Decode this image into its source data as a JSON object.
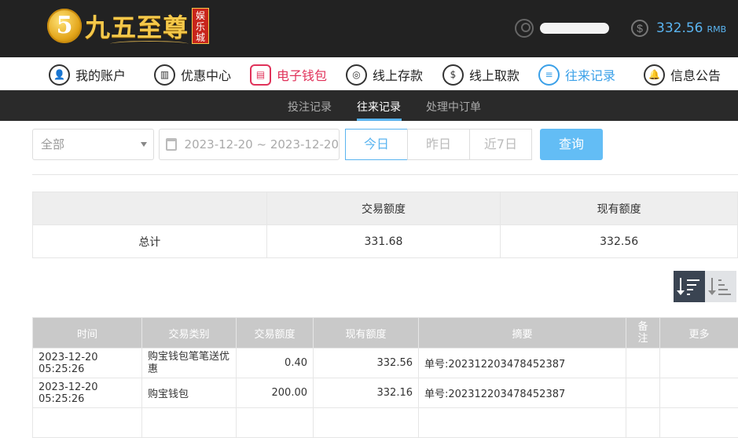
{
  "header": {
    "logo_badge": "5",
    "logo_text": "九五至尊",
    "logo_tag": "娱乐城",
    "balance_amount": "332.56",
    "balance_unit": "RMB"
  },
  "main_nav": [
    {
      "label": "我的账户",
      "icon": "user-circle-icon"
    },
    {
      "label": "优惠中心",
      "icon": "gift-icon"
    },
    {
      "label": "电子钱包",
      "icon": "wallet-icon"
    },
    {
      "label": "线上存款",
      "icon": "deposit-icon"
    },
    {
      "label": "线上取款",
      "icon": "withdraw-icon"
    },
    {
      "label": "往来记录",
      "icon": "records-icon"
    },
    {
      "label": "信息公告",
      "icon": "bell-icon"
    }
  ],
  "sub_nav": [
    {
      "label": "投注记录"
    },
    {
      "label": "往来记录"
    },
    {
      "label": "处理中订单"
    }
  ],
  "filters": {
    "type_select": "全部",
    "date_range": "2023-12-20 ~ 2023-12-20",
    "quick_today": "今日",
    "quick_yesterday": "昨日",
    "quick_7days": "近7日",
    "query_label": "查询"
  },
  "summary": {
    "col_trade": "交易额度",
    "col_current": "现有额度",
    "row_label": "总计",
    "trade_total": "331.68",
    "current_total": "332.56"
  },
  "records": {
    "headers": [
      "时间",
      "交易类别",
      "交易额度",
      "现有额度",
      "摘要",
      "备注",
      "更多"
    ],
    "rows": [
      {
        "time": "2023-12-20 05:25:26",
        "type": "购宝钱包笔笔送优惠",
        "amount": "0.40",
        "balance": "332.56",
        "summary": "单号:202312203478452387"
      },
      {
        "time": "2023-12-20 05:25:26",
        "type": "购宝钱包",
        "amount": "200.00",
        "balance": "332.16",
        "summary": "单号:202312203478452387"
      }
    ]
  },
  "colors": {
    "accent_blue": "#5ab4f0",
    "accent_red": "#e0325a",
    "topbar_bg": "#222222"
  }
}
